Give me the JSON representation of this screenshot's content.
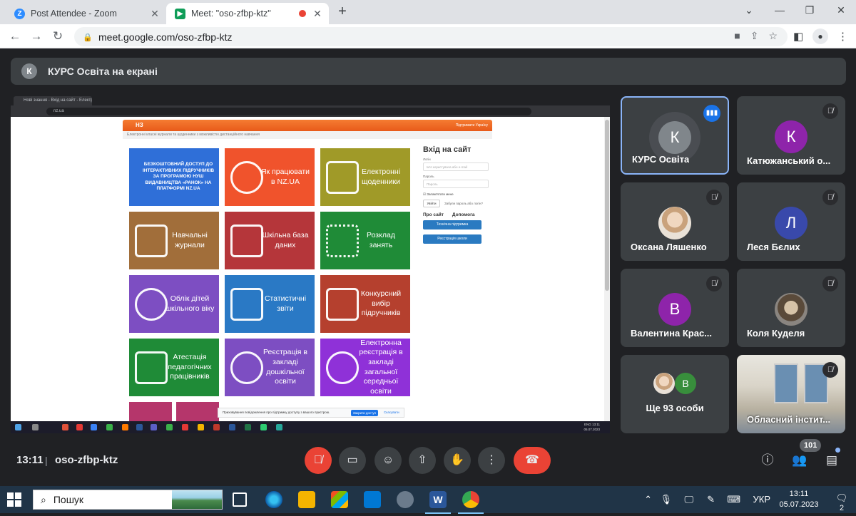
{
  "browser": {
    "tabs": [
      {
        "title": "Post Attendee - Zoom",
        "icon": "zoom-icon"
      },
      {
        "title": "Meet: \"oso-zfbp-ktz\"",
        "icon": "meet-icon",
        "active": true
      }
    ],
    "url": "meet.google.com/oso-zfbp-ktz"
  },
  "presentation": {
    "banner_initial": "К",
    "banner_text": "КУРС Освіта на екрані"
  },
  "shared_screen": {
    "tab_title": "Нові знання - Вхід на сайт - Електр...",
    "url": "nz.ua",
    "site_logo": "НЗ",
    "header_right": "Підтримати Україну",
    "subheader": "Електронні класні журнали та щоденники з можливістю дистанційного навчання",
    "promo": "Безкоштовний доступ до інтерактивних підручників за програмою НУШ видавництва «Ранок» на платформі NZ.UA",
    "tiles": [
      {
        "label": "Як працювати в NZ.UA",
        "color": "#f0532c"
      },
      {
        "label": "Електронні щоденники",
        "color": "#a09a28"
      },
      {
        "label": "Навчальні журнали",
        "color": "#a16e3a"
      },
      {
        "label": "Шкільна база даних",
        "color": "#b5363a"
      },
      {
        "label": "Розклад занять",
        "color": "#1f8b37"
      },
      {
        "label": "Облік дітей шкільного віку",
        "color": "#7d4ec2"
      },
      {
        "label": "Статистичні звіти",
        "color": "#2a79c5"
      },
      {
        "label": "Конкурсний вибір підручників",
        "color": "#b5402e"
      },
      {
        "label": "Атестація педагогічних працівників",
        "color": "#1f8b37"
      },
      {
        "label": "Реєстрація в закладі дошкільної освіти",
        "color": "#7d4ec2"
      },
      {
        "label": "Електронна реєстрація в закладі загальної середньої освіти",
        "color": "#8f31d8"
      }
    ],
    "login": {
      "title": "Вхід на сайт",
      "login_label": "Логін",
      "login_placeholder": "Ім'я користувача або e-mail",
      "password_label": "Пароль",
      "password_placeholder": "Пароль",
      "remember": "Запам'ятати мене",
      "submit": "Увійти",
      "forgot": "Забули пароль або логін?",
      "about": "Про сайт",
      "help": "Допомога",
      "support": "Технічна підтримка",
      "register_school": "Реєстрація школи"
    },
    "cookie": {
      "text": "Приховування повідомлення про підтримку доступу з вашого пристрою.",
      "accept": "Закрити доступ",
      "cancel": "Скасувати"
    },
    "tray_time": "13:11",
    "tray_date": "05.07.2023",
    "tray_lang": "ENG"
  },
  "participants": [
    {
      "name": "КУРС Освіта",
      "initial": "К",
      "color": "#80868b",
      "speaking": true
    },
    {
      "name": "Катюжанський о...",
      "initial": "К",
      "color": "#8e24aa",
      "muted": true
    },
    {
      "name": "Оксана Ляшенко",
      "photo": true,
      "muted": true
    },
    {
      "name": "Леся Бєлих",
      "initial": "Л",
      "color": "#3949ab",
      "muted": true
    },
    {
      "name": "Валентина Крас...",
      "initial": "В",
      "color": "#8e24aa",
      "muted": true
    },
    {
      "name": "Коля Куделя",
      "photo": true,
      "muted": true
    },
    {
      "name": "Ще 93 особи",
      "initial": "В",
      "color": "#388e3c"
    },
    {
      "name": "Обласний інстит...",
      "photo": true,
      "muted": true
    }
  ],
  "meeting": {
    "time": "13:11",
    "code": "oso-zfbp-ktz",
    "people_count": "101",
    "colors": {
      "danger": "#ea4335",
      "control": "#3c4043",
      "accent": "#8ab4f8"
    }
  },
  "taskbar": {
    "search_placeholder": "Пошук",
    "lang": "УКР",
    "time": "13:11",
    "date": "05.07.2023",
    "notifications": "2"
  }
}
